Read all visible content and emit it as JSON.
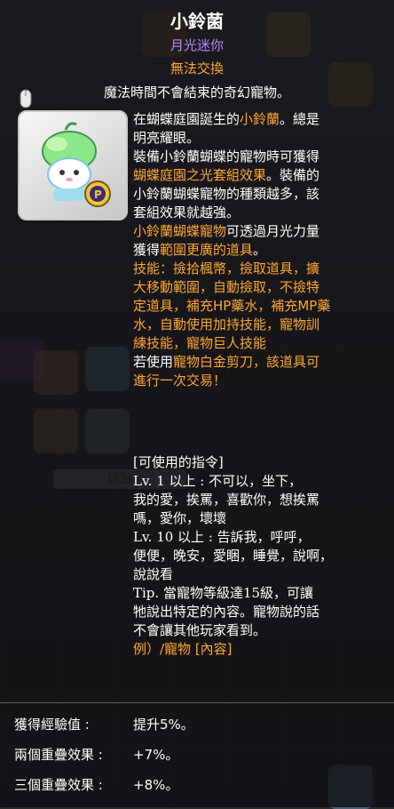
{
  "item": {
    "name": "小鈴菌",
    "subtitle": "月光迷你",
    "tradability": "無法交換",
    "tagline": "魔法時間不會結束的奇幻寵物。",
    "icon": "pet-mushroom-icon"
  },
  "description": {
    "line1": "在蝴蝶庭園誕生的",
    "line1_highlight": "小鈴蘭",
    "line1_end": "。總是",
    "line2": "明亮耀眼。",
    "line3": "裝備小鈴蘭蝴蝶的寵物時可獲得",
    "line4_highlight": "蝴蝶庭園之光套組效果",
    "line4_end": "。裝備的",
    "line5": "小鈴蘭蝴蝶寵物的種類越多，該",
    "line6": "套組效果就越強。",
    "line7_highlight": "小鈴蘭蝴蝶寵物",
    "line7_end": "可透過月光力量",
    "line8_start": "獲得",
    "line8_highlight": "範圍更廣的道具",
    "line8_end": "。",
    "skills_l1": "技能：撿拾楓幣，撿取道具，擴",
    "skills_l2": "大移動範圍，自動撿取，不撿特",
    "skills_l3": "定道具，補充HP藥水，補充MP藥",
    "skills_l4": "水，自動使用加持技能，寵物訓",
    "skills_l5": "練技能，寵物巨人技能",
    "trade_l1_start": "若使用",
    "trade_l1_highlight": "寵物白金剪刀，該道具可",
    "trade_l2_highlight": "進行一次交易！"
  },
  "commands": {
    "header": "[可使用的指令]",
    "lv1_l1": "Lv. 1 以上 : 不可以，坐下，",
    "lv1_l2": "我的愛，挨罵，喜歡你，想挨罵",
    "lv1_l3": "嗎，愛你，壞壞",
    "lv10_l1": "Lv. 10 以上 : 告訴我，呼呼，",
    "lv10_l2": "便便，晚安，愛睏，睡覺，說啊，",
    "lv10_l3": "說說看",
    "tip_l1": "Tip. 當寵物等級達15級，可讓",
    "tip_l2": "牠說出特定的內容。寵物說的話",
    "tip_l3": "不會讓其他玩家看到。",
    "example": "例）/寵物 [內容]"
  },
  "stats": [
    {
      "label": "獲得經驗值 :",
      "value": "提升5%。"
    },
    {
      "label": "兩個重疊效果 :",
      "value": "+7%。"
    },
    {
      "label": "三個重疊效果 :",
      "value": "+8%。"
    }
  ],
  "background": {
    "search_label": "攔點"
  },
  "colors": {
    "highlight": "#ffa733",
    "subtitle": "#b889ff"
  }
}
